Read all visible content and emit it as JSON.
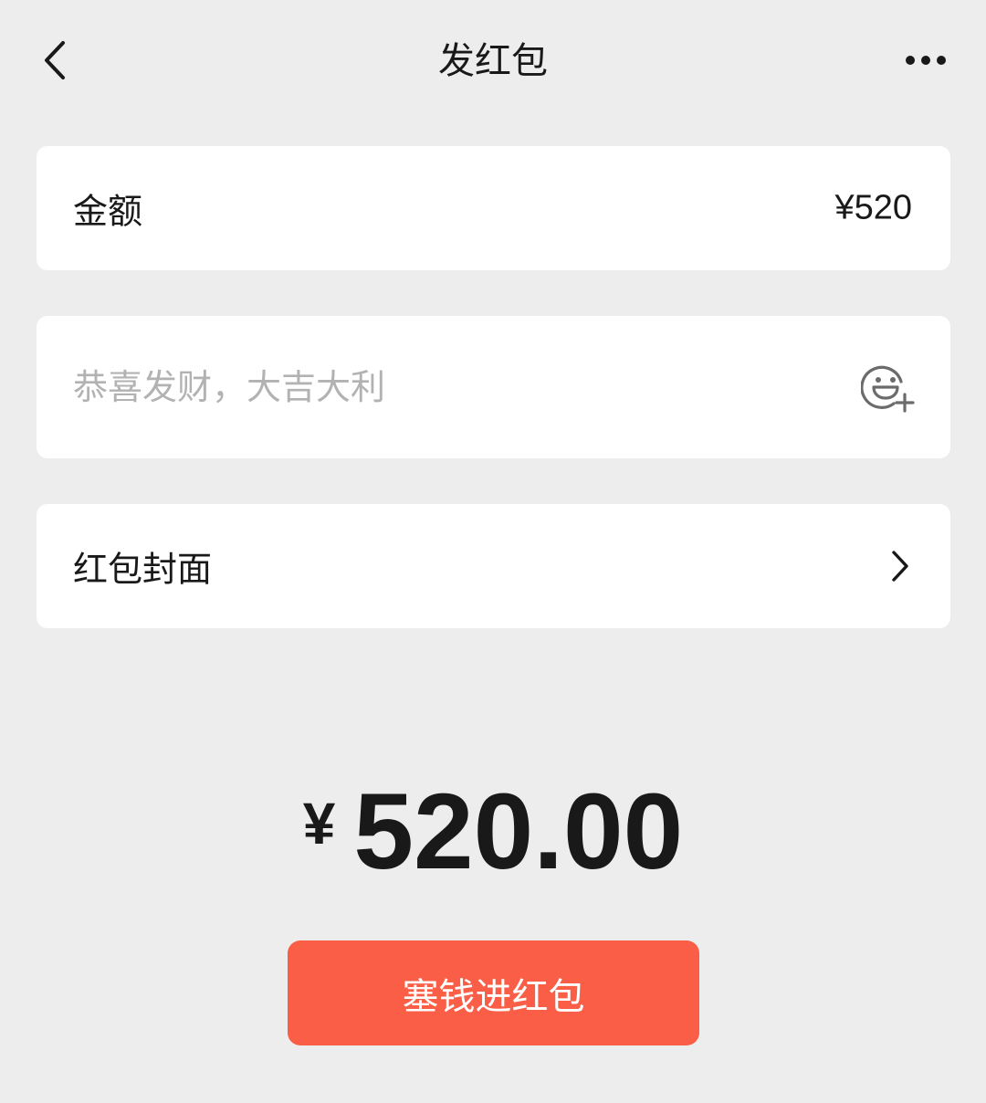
{
  "nav": {
    "title": "发红包"
  },
  "amount_row": {
    "label": "金额",
    "value": "¥520"
  },
  "greeting_row": {
    "placeholder": "恭喜发财，大吉大利",
    "value": ""
  },
  "cover_row": {
    "label": "红包封面"
  },
  "total": {
    "currency": "¥",
    "amount": "520.00"
  },
  "send_button": {
    "label": "塞钱进红包"
  },
  "colors": {
    "background": "#ededed",
    "card": "#ffffff",
    "accent": "#fa5e47",
    "text": "#191919",
    "placeholder": "#b2b2b2"
  },
  "icons": {
    "back": "chevron-left-icon",
    "more": "ellipsis-icon",
    "emoji": "emoji-add-icon",
    "cover_arrow": "chevron-right-icon"
  }
}
